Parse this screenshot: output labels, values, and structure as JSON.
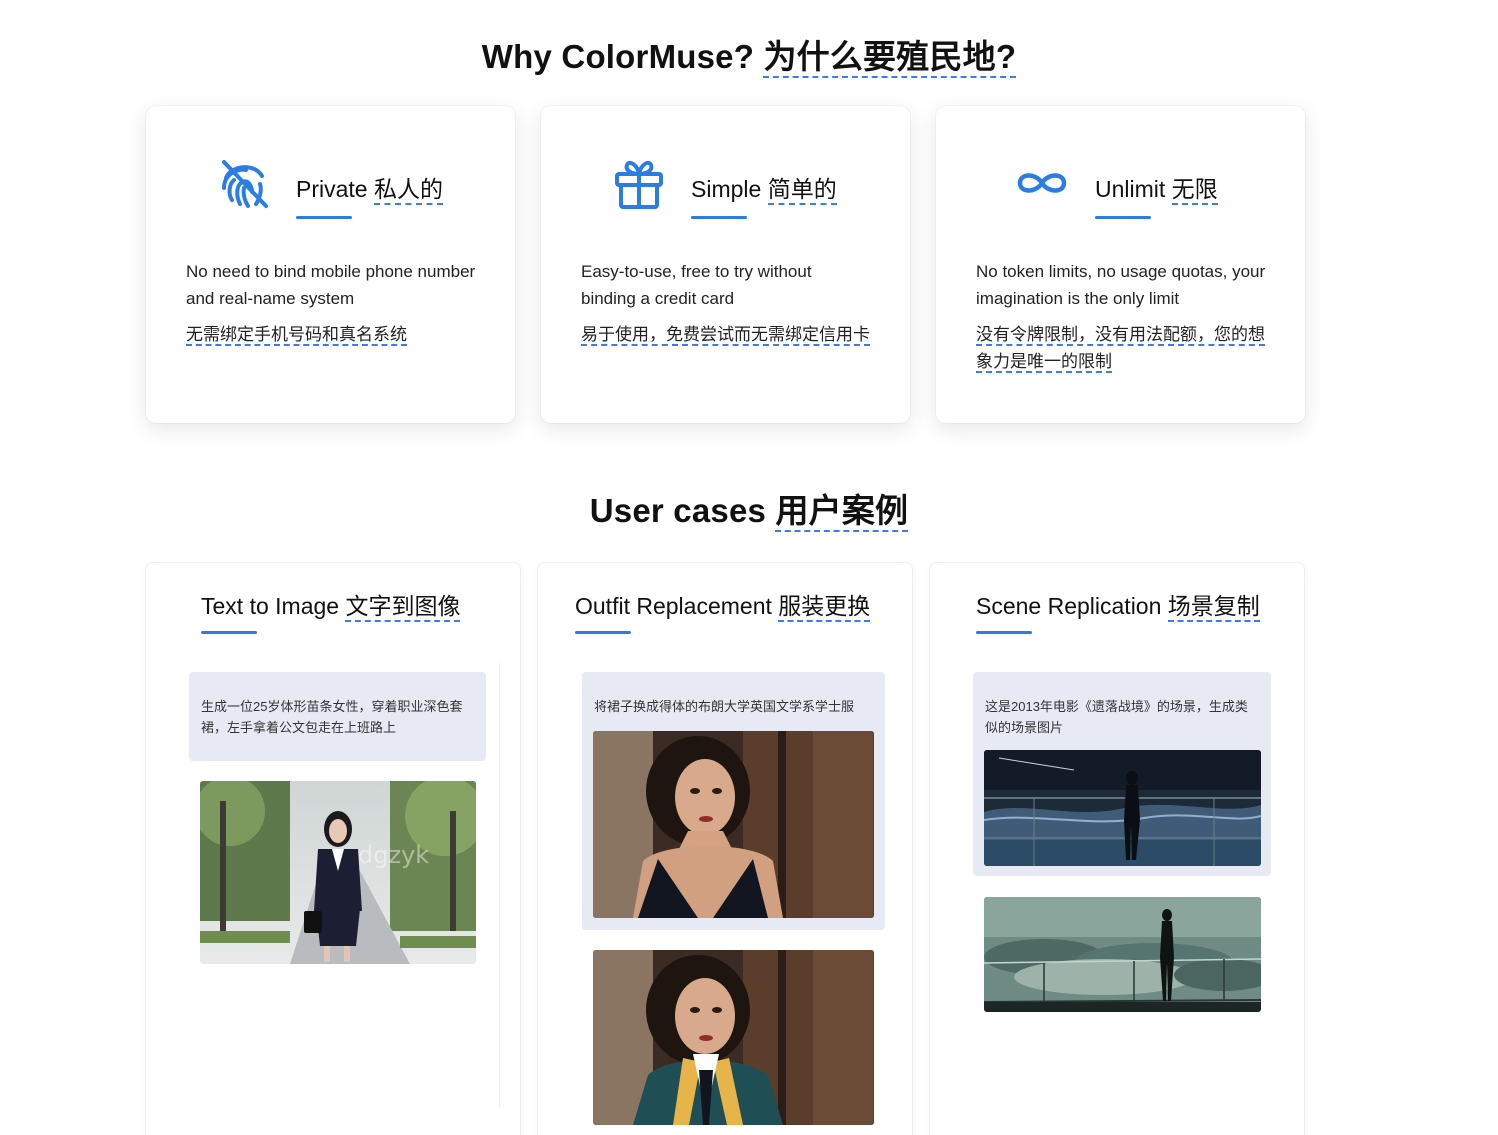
{
  "why": {
    "title_en": "Why ColorMuse?",
    "title_zh": "为什么要殖民地?"
  },
  "features": [
    {
      "icon": "fingerprint-off-icon",
      "title_en": "Private",
      "title_zh": "私人的",
      "desc_en": "No need to bind mobile phone number and real-name system",
      "desc_zh": "无需绑定手机号码和真名系统"
    },
    {
      "icon": "gift-icon",
      "title_en": "Simple",
      "title_zh": "简单的",
      "desc_en": "Easy-to-use, free to try without binding a credit card",
      "desc_zh": "易于使用，免费尝试而无需绑定信用卡"
    },
    {
      "icon": "infinity-icon",
      "title_en": "Unlimit",
      "title_zh": "无限",
      "desc_en": "No token limits, no usage quotas, your imagination is the only limit",
      "desc_zh": "没有令牌限制，没有用法配额，您的想象力是唯一的限制"
    }
  ],
  "cases": {
    "title_en": "User cases",
    "title_zh": "用户案例",
    "items": [
      {
        "title_en": "Text to Image",
        "title_zh": "文字到图像",
        "prompt": "生成一位25岁体形苗条女性，穿着职业深色套裙，左手拿着公文包走在上班路上",
        "watermark": "dgzyk"
      },
      {
        "title_en": "Outfit Replacement",
        "title_zh": "服装更换",
        "prompt": "将裙子换成得体的布朗大学英国文学系学士服"
      },
      {
        "title_en": "Scene Replication",
        "title_zh": "场景复制",
        "prompt": "这是2013年电影《遗落战境》的场景，生成类似的场景图片"
      }
    ]
  },
  "colors": {
    "accent": "#2b7de1",
    "dashed_underline": "#3b7bf0",
    "prompt_bg": "#e7eaf4"
  }
}
